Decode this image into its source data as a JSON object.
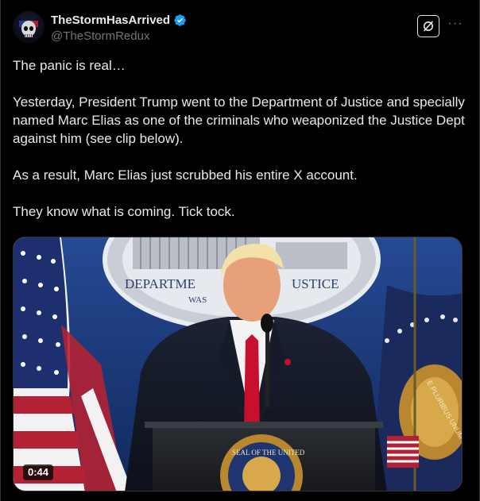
{
  "post": {
    "author": {
      "display_name": "TheStormHasArrived",
      "handle": "@TheStormRedux",
      "verified": true,
      "avatar_icon": "skull-flag-avatar"
    },
    "actions": {
      "grok_icon": "grok-icon",
      "more_icon": "more-icon",
      "more_label": "···"
    },
    "paragraphs": [
      "The panic is real…",
      "Yesterday, President Trump went to the Department of Justice and specially named Marc Elias as one of the criminals who weaponized the Justice Dept against him (see clip below).",
      "As a result, Marc Elias just scrubbed his entire X account.",
      "They know what is coming. Tick tock."
    ],
    "media": {
      "type": "video",
      "duration": "0:44",
      "backdrop_text_1": "DEPARTME",
      "backdrop_text_2": "USTICE",
      "backdrop_text_3": "WAS",
      "podium_seal_text": "SEAL OF THE UNITED",
      "flag_text": "E PLURIBUS UNUM"
    }
  },
  "colors": {
    "background": "#000000",
    "text": "#e7e9ea",
    "secondary": "#71767b",
    "verified": "#1d9bf0",
    "border": "#2f3336"
  }
}
